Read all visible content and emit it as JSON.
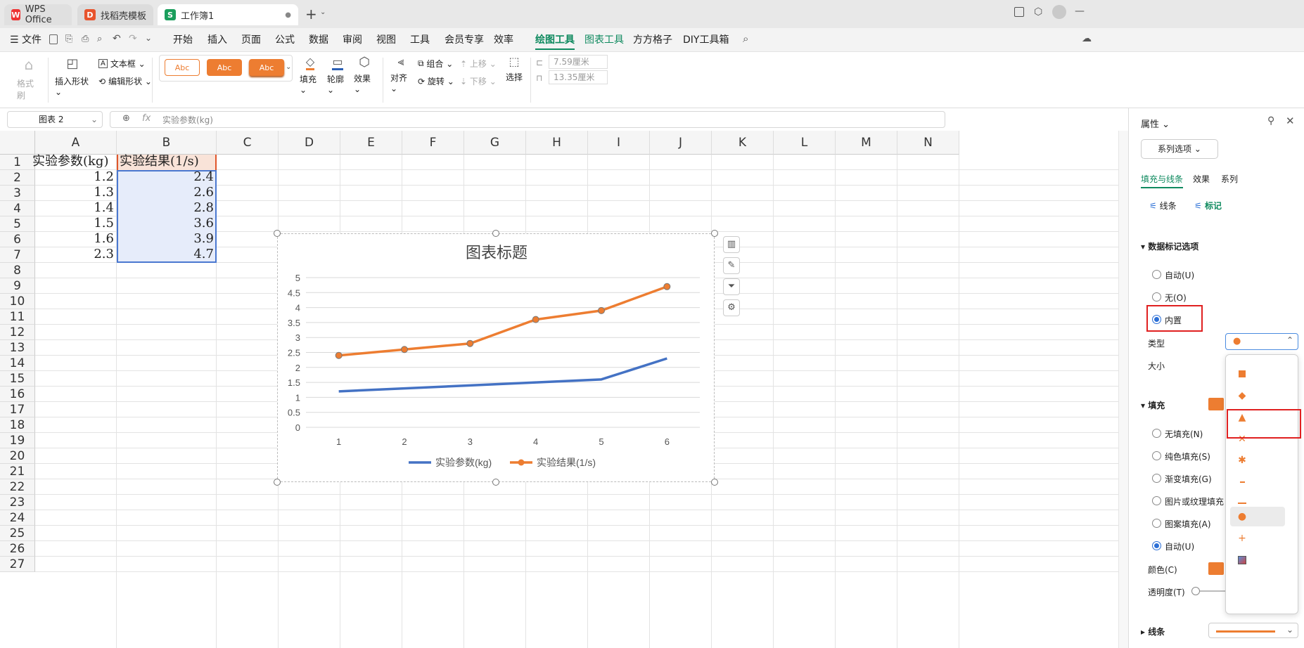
{
  "titlebar": {
    "tabs": [
      {
        "label": "WPS Office",
        "icon": "wps-logo-icon"
      },
      {
        "label": "找稻壳模板",
        "icon": "docer-icon"
      },
      {
        "label": "工作簿1",
        "icon": "sheet-icon",
        "glyph": "S"
      }
    ],
    "new_tab": "+"
  },
  "menu": {
    "file": "文件",
    "items": [
      "开始",
      "插入",
      "页面",
      "公式",
      "数据",
      "审阅",
      "视图",
      "工具",
      "会员专享",
      "效率",
      "绘图工具",
      "图表工具",
      "方方格子",
      "DIY工具箱"
    ],
    "active": "绘图工具"
  },
  "ribbon": {
    "format_painter": "格式刷",
    "insert_shape": "插入形状",
    "textbox": "文本框",
    "edit_shape": "编辑形状",
    "style_abc": [
      "Abc",
      "Abc",
      "Abc"
    ],
    "fill": "填充",
    "outline": "轮廓",
    "effect": "效果",
    "align": "对齐",
    "group": "组合",
    "rotate": "旋转",
    "move_up": "上移",
    "move_down": "下移",
    "select": "选择",
    "height": "7.59厘米",
    "width": "13.35厘米"
  },
  "formula": {
    "name_box": "图表 2",
    "fx": "fx",
    "content": "实验参数(kg)"
  },
  "sheet": {
    "columns": [
      "A",
      "B",
      "C",
      "D",
      "E",
      "F",
      "G",
      "H",
      "I",
      "J",
      "K",
      "L",
      "M",
      "N"
    ],
    "rows": [
      "1",
      "2",
      "3",
      "4",
      "5",
      "6",
      "7",
      "8",
      "9",
      "10",
      "11",
      "12",
      "13",
      "14",
      "15",
      "16",
      "17",
      "18",
      "19",
      "20",
      "21",
      "22",
      "23",
      "24",
      "25",
      "26",
      "27"
    ],
    "header_a": "实验参数(kg)",
    "header_b": "实验结果(1/s)",
    "col_a": [
      "1.2",
      "1.3",
      "1.4",
      "1.5",
      "1.6",
      "2.3"
    ],
    "col_b": [
      "2.4",
      "2.6",
      "2.8",
      "3.6",
      "3.9",
      "4.7"
    ]
  },
  "chart_data": {
    "type": "line",
    "title": "图表标题",
    "categories": [
      "1",
      "2",
      "3",
      "4",
      "5",
      "6"
    ],
    "ylim": [
      0,
      5
    ],
    "yticks": [
      "0",
      "0.5",
      "1",
      "1.5",
      "2",
      "2.5",
      "3",
      "3.5",
      "4",
      "4.5",
      "5"
    ],
    "grid": true,
    "legend": "bottom",
    "series": [
      {
        "name": "实验参数(kg)",
        "values": [
          1.2,
          1.3,
          1.4,
          1.5,
          1.6,
          2.3
        ],
        "color": "#4472c4"
      },
      {
        "name": "实验结果(1/s)",
        "values": [
          2.4,
          2.6,
          2.8,
          3.6,
          3.9,
          4.7
        ],
        "color": "#ed7d31"
      }
    ]
  },
  "panel": {
    "title": "属性",
    "series_options": "系列选项",
    "tabs": [
      "填充与线条",
      "效果",
      "系列"
    ],
    "subtabs": [
      "线条",
      "标记"
    ],
    "marker_section": "数据标记选项",
    "marker_options": [
      "自动(U)",
      "无(O)",
      "内置"
    ],
    "type_label": "类型",
    "size_label": "大小",
    "fill_section": "填充",
    "fill_options": [
      "无填充(N)",
      "纯色填充(S)",
      "渐变填充(G)",
      "图片或纹理填充",
      "图案填充(A)",
      "自动(U)"
    ],
    "color_label": "颜色(C)",
    "transparency_label": "透明度(T)",
    "line_section": "线条",
    "marker_types": [
      "square",
      "diamond",
      "triangle",
      "x",
      "star",
      "short-dash",
      "long-dash",
      "circle",
      "plus",
      "picture"
    ],
    "accent": "#ed7d31"
  }
}
